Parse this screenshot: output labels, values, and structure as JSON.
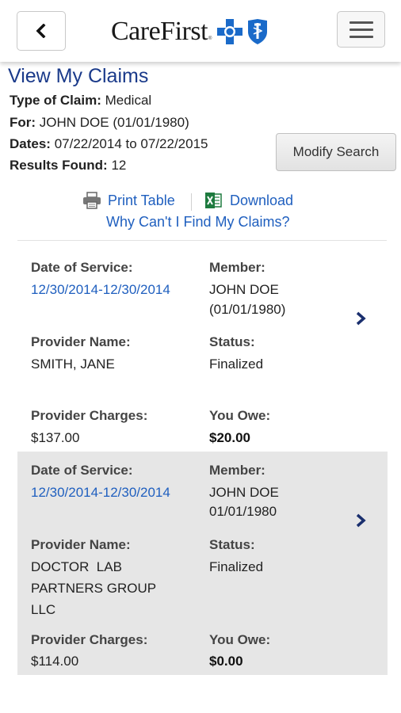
{
  "header": {
    "back_icon": "chevron-left-icon",
    "logo_text": "CareFirst",
    "logo_tm": "®",
    "menu_icon": "hamburger-menu-icon"
  },
  "page_title": "View My Claims",
  "search_info": {
    "type_label": "Type of Claim:",
    "type_value": "Medical",
    "for_label": "For:",
    "for_value": "JOHN DOE (01/01/1980)",
    "dates_label": "Dates:",
    "dates_value": "07/22/2014 to 07/22/2015",
    "results_label": "Results Found:",
    "results_value": "12"
  },
  "modify_button": "Modify Search",
  "actions": {
    "print": "Print Table",
    "download": "Download",
    "why": "Why Can't I Find My Claims?"
  },
  "claims": [
    {
      "date_label": "Date of Service:",
      "date_value": "12/30/2014-12/30/2014",
      "member_label": "Member:",
      "member_line1": "JOHN DOE",
      "member_line2": "(01/01/1980)",
      "provider_label": "Provider Name:",
      "provider_line1": "SMITH, JANE",
      "status_label": "Status:",
      "status_value": "Finalized",
      "charges_label": "Provider Charges:",
      "charges_value": "$137.00",
      "owe_label": "You Owe:",
      "owe_value": "$20.00"
    },
    {
      "date_label": "Date of Service:",
      "date_value": "12/30/2014-12/30/2014",
      "member_label": "Member:",
      "member_line1": "JOHN DOE",
      "member_line2": "01/01/1980",
      "provider_label": "Provider Name:",
      "provider_line1": "DOCTOR  LAB",
      "provider_line2": "PARTNERS GROUP",
      "provider_line3": "LLC",
      "status_label": "Status:",
      "status_value": "Finalized",
      "charges_label": "Provider Charges:",
      "charges_value": "$114.00",
      "owe_label": "You Owe:",
      "owe_value": "$0.00"
    }
  ],
  "colors": {
    "title_blue": "#1a3a8a",
    "link_blue": "#1f5fbf",
    "logo_blue": "#1a6ac9",
    "shaded_row": "#e6e6e6"
  }
}
